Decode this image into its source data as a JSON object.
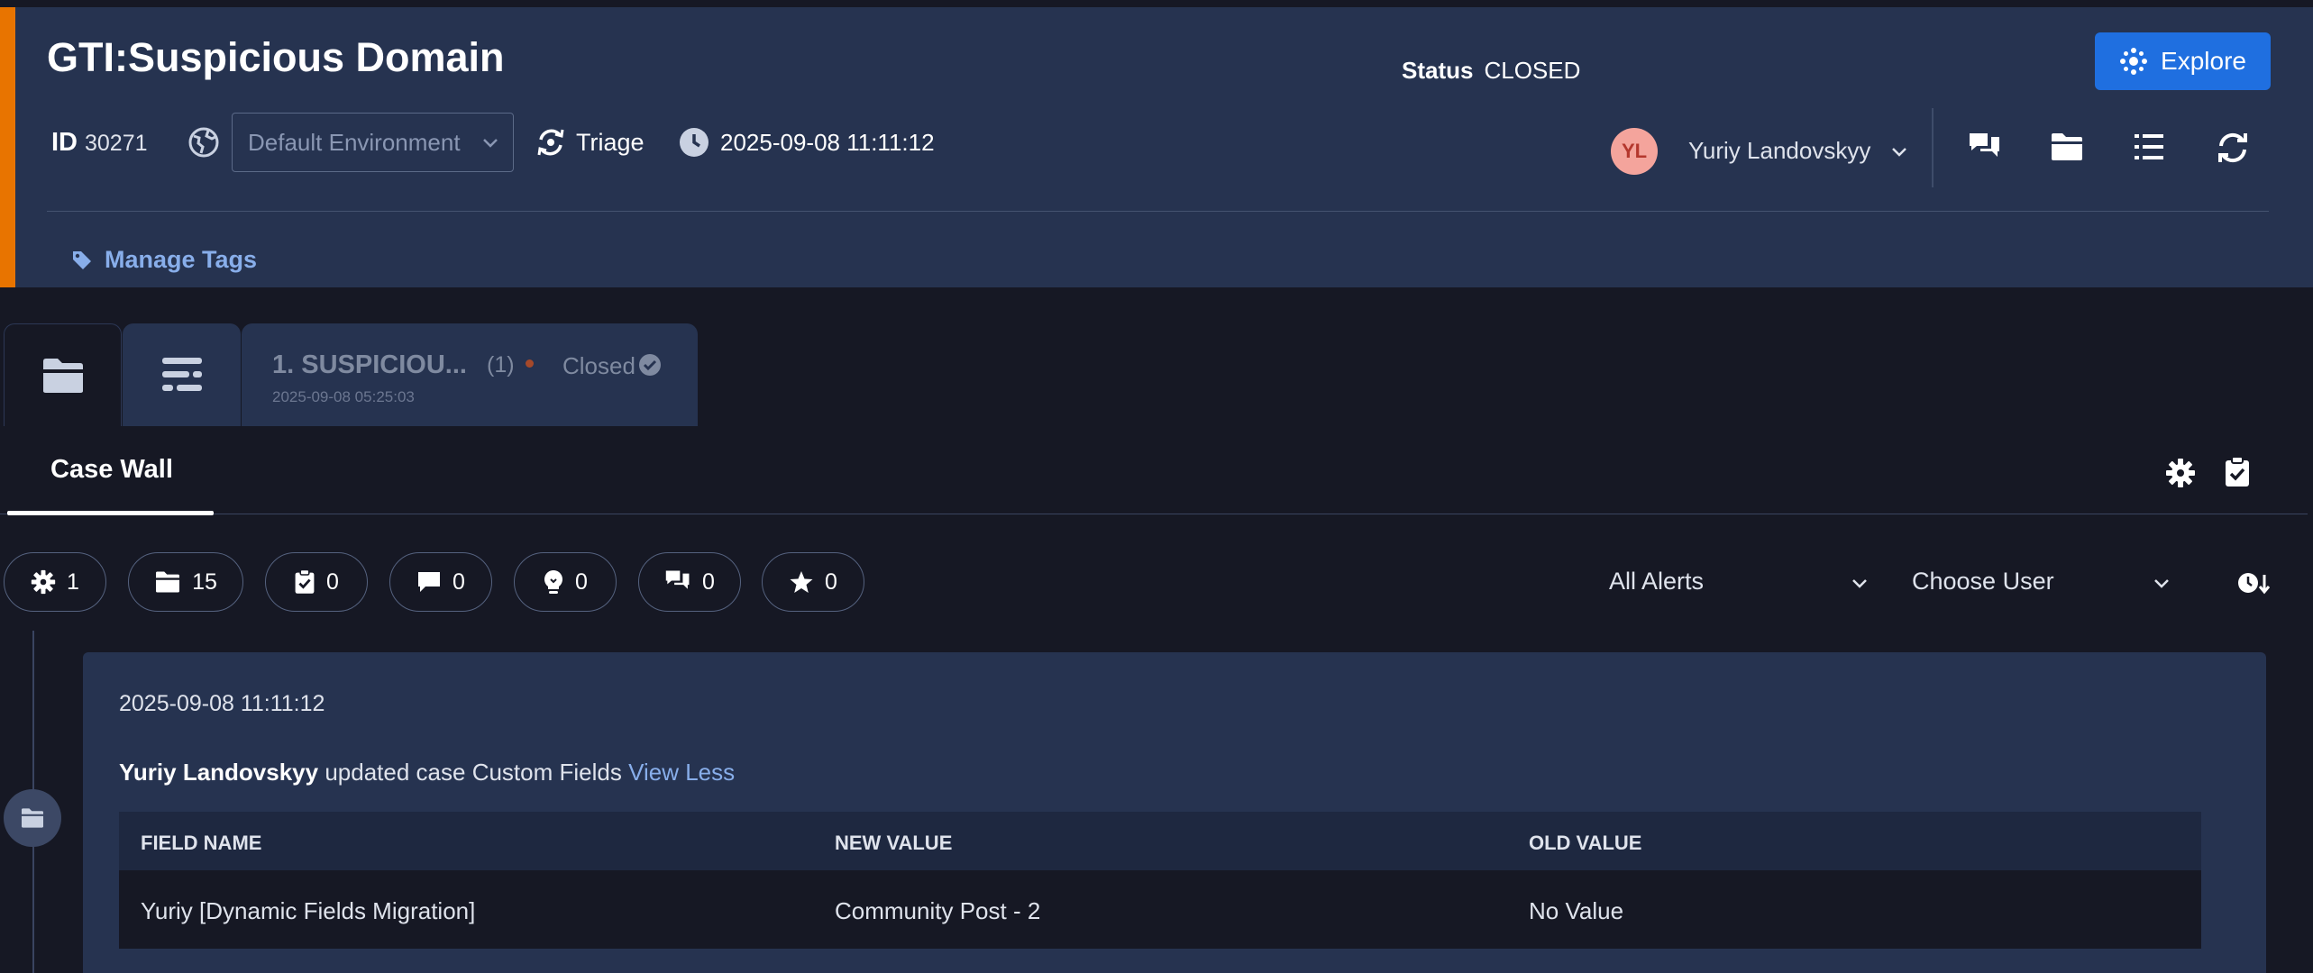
{
  "case": {
    "title": "GTI:Suspicious Domain",
    "status_label": "Status",
    "status_value": "CLOSED",
    "explore_label": "Explore",
    "id_label": "ID",
    "id_value": "30271",
    "environment_placeholder": "Default Environment",
    "stage": "Triage",
    "created": "2025-09-08 11:11:12",
    "owner_initials": "YL",
    "owner_name": "Yuriy Landovskyy",
    "manage_tags_label": "Manage Tags"
  },
  "alert_tab": {
    "name": "1. SUSPICIOU...",
    "count": "(1)",
    "status": "Closed",
    "date": "2025-09-08 05:25:03"
  },
  "case_wall": {
    "title": "Case Wall",
    "filters": [
      {
        "icon": "gear-icon",
        "count": "1"
      },
      {
        "icon": "folder-icon",
        "count": "15"
      },
      {
        "icon": "clipboard-check-icon",
        "count": "0"
      },
      {
        "icon": "comment-icon",
        "count": "0"
      },
      {
        "icon": "lightbulb-icon",
        "count": "0"
      },
      {
        "icon": "chat-icon",
        "count": "0"
      },
      {
        "icon": "star-icon",
        "count": "0"
      }
    ],
    "alerts_filter": "All Alerts",
    "user_filter": "Choose User"
  },
  "entry": {
    "time": "2025-09-08 11:11:12",
    "user": "Yuriy Landovskyy",
    "action": "updated case Custom Fields",
    "toggle_label": "View Less",
    "columns": [
      "FIELD NAME",
      "NEW VALUE",
      "OLD VALUE"
    ],
    "rows": [
      [
        "Yuriy [Dynamic Fields Migration]",
        "Community Post - 2",
        "No Value"
      ]
    ]
  },
  "colors": {
    "header_bg": "#263350",
    "accent": "#e87400",
    "primary": "#1f6fe0",
    "link": "#88aeea",
    "page_bg": "#161824"
  }
}
